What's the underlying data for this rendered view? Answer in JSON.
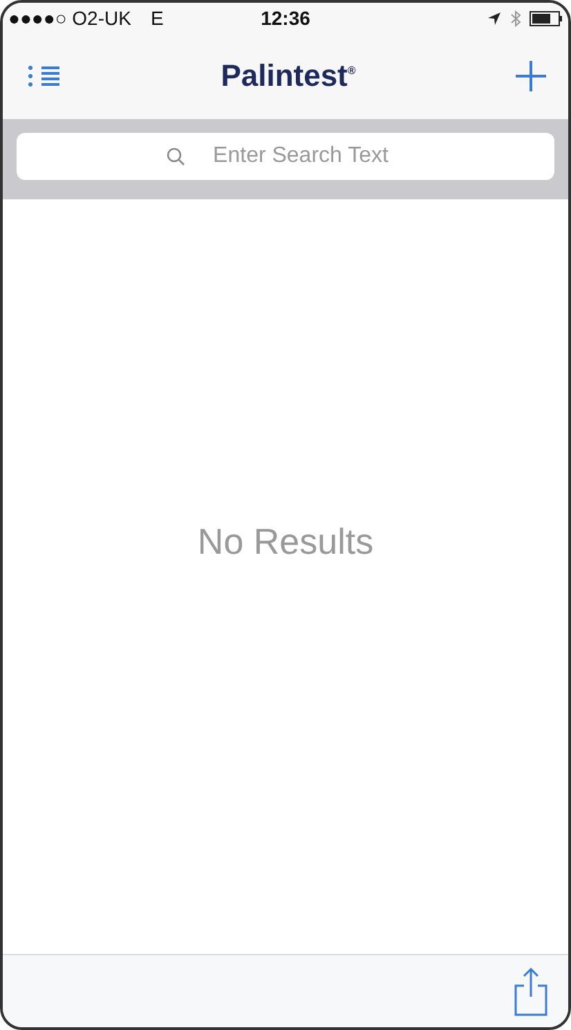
{
  "status_bar": {
    "carrier": "●●●●○ O2-UK",
    "network": "E",
    "time": "12:36"
  },
  "nav_bar": {
    "title": "Palintest$^{®}$"
  },
  "search": {
    "placeholder": "Enter Search Text"
  },
  "empty_message": "No Results"
}
